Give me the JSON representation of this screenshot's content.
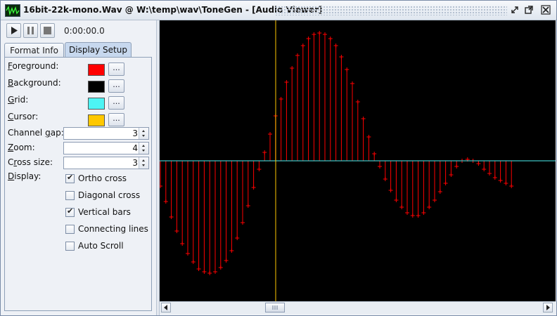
{
  "window": {
    "title": "16bit-22k-mono.Wav @ W:\\temp\\wav\\ToneGen - [Audio Viewer]"
  },
  "toolbar": {
    "time": "0:00:00.0"
  },
  "tabs": [
    {
      "label": "Format Info",
      "active": false
    },
    {
      "label": "Display Setup",
      "active": true
    }
  ],
  "display_setup": {
    "colors": [
      {
        "pre": "",
        "key": "F",
        "post": "oreground:",
        "color": "#ff0000",
        "button": "..."
      },
      {
        "pre": "",
        "key": "B",
        "post": "ackground:",
        "color": "#000000",
        "button": "..."
      },
      {
        "pre": "",
        "key": "G",
        "post": "rid:",
        "color": "#4cf4f4",
        "button": "..."
      },
      {
        "pre": "",
        "key": "C",
        "post": "ursor:",
        "color": "#ffc800",
        "button": "..."
      }
    ],
    "spinners": [
      {
        "pre": "Channel ",
        "key": "g",
        "post": "ap:",
        "value": "3"
      },
      {
        "pre": "",
        "key": "Z",
        "post": "oom:",
        "value": "4"
      },
      {
        "pre": "C",
        "key": "r",
        "post": "oss size:",
        "value": "3"
      }
    ],
    "display_label": {
      "pre": "",
      "key": "D",
      "post": "isplay:"
    },
    "checkboxes": [
      {
        "label": "Ortho cross",
        "checked": true
      },
      {
        "label": "Diagonal cross",
        "checked": false
      },
      {
        "label": "Vertical bars",
        "checked": true
      },
      {
        "label": "Connecting lines",
        "checked": false
      },
      {
        "label": "Auto Scroll",
        "checked": false
      }
    ]
  },
  "waveform": {
    "samples": [
      -0.18,
      -0.29,
      -0.4,
      -0.5,
      -0.59,
      -0.66,
      -0.72,
      -0.77,
      -0.79,
      -0.8,
      -0.79,
      -0.76,
      -0.71,
      -0.64,
      -0.55,
      -0.44,
      -0.32,
      -0.19,
      -0.06,
      0.06,
      0.19,
      0.32,
      0.44,
      0.56,
      0.66,
      0.75,
      0.82,
      0.87,
      0.9,
      0.91,
      0.9,
      0.87,
      0.82,
      0.74,
      0.65,
      0.55,
      0.42,
      0.3,
      0.17,
      0.05,
      -0.04,
      -0.13,
      -0.21,
      -0.28,
      -0.33,
      -0.37,
      -0.39,
      -0.39,
      -0.37,
      -0.33,
      -0.28,
      -0.22,
      -0.16,
      -0.1,
      -0.04,
      0.0,
      0.01,
      0.0,
      -0.02,
      -0.06,
      -0.09,
      -0.12,
      -0.14,
      -0.16,
      -0.18
    ],
    "colors": {
      "foreground": "#ff0000",
      "background": "#000000",
      "grid": "#4cf4f4",
      "cursor": "#ffc800"
    }
  },
  "icons": [
    "app-icon",
    "minimize-icon",
    "maximize-icon",
    "close-icon",
    "play-icon",
    "pause-icon",
    "stop-icon",
    "scroll-left-icon",
    "scroll-right-icon"
  ]
}
